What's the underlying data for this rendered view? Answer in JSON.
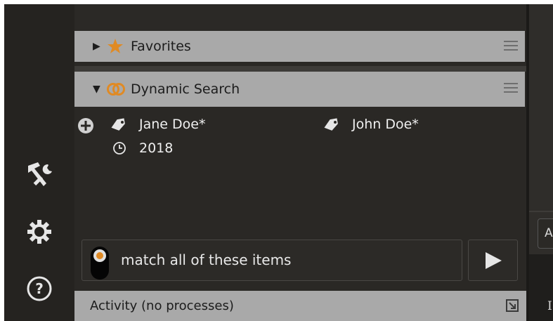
{
  "favorites": {
    "label": "Favorites",
    "expanded": false
  },
  "dynamic_search": {
    "label": "Dynamic Search",
    "expanded": true,
    "items": [
      {
        "icon": "tag-icon",
        "label": "Jane Doe*"
      },
      {
        "icon": "tag-icon",
        "label": "John Doe*"
      },
      {
        "icon": "clock-icon",
        "label": "2018"
      }
    ]
  },
  "match": {
    "label": "match all of these items",
    "toggle_on": true
  },
  "activity": {
    "label": "Activity (no processes)"
  },
  "right_panel": {
    "button_char": "A",
    "text_char": "I"
  },
  "colors": {
    "accent": "#e08a24",
    "header_bg": "#a9a9a9",
    "panel_bg": "#2a2825"
  }
}
